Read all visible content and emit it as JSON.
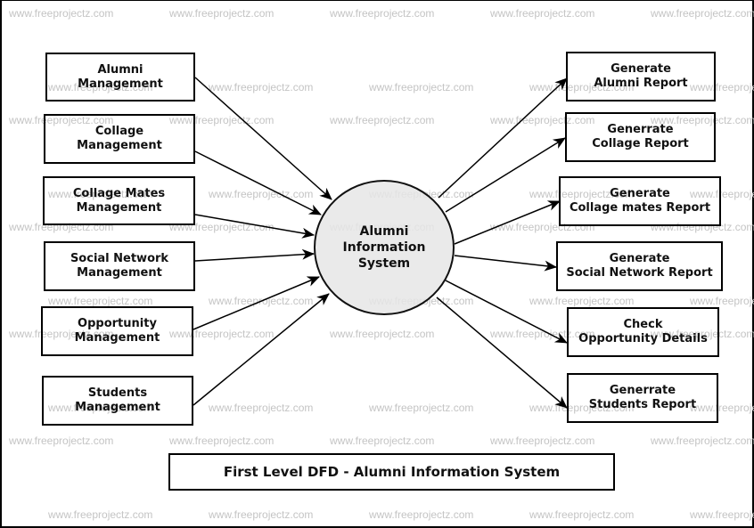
{
  "diagram": {
    "title": "First Level DFD - Alumni Information System",
    "watermark": "www.freeprojectz.com",
    "process": {
      "line1": "Alumni",
      "line2": "Information",
      "line3": "System"
    },
    "inputs": [
      {
        "line1": "Alumni",
        "line2": "Management"
      },
      {
        "line1": "Collage",
        "line2": "Management"
      },
      {
        "line1": "Collage Mates",
        "line2": "Management"
      },
      {
        "line1": "Social Network",
        "line2": "Management"
      },
      {
        "line1": "Opportunity",
        "line2": "Management"
      },
      {
        "line1": "Students",
        "line2": "Management"
      }
    ],
    "outputs": [
      {
        "line1": "Generate",
        "line2": "Alumni Report"
      },
      {
        "line1": "Generrate",
        "line2": "Collage Report"
      },
      {
        "line1": "Generate",
        "line2": "Collage mates Report"
      },
      {
        "line1": "Generate",
        "line2": "Social Network Report"
      },
      {
        "line1": "Check",
        "line2": "Opportunity Details"
      },
      {
        "line1": "Generrate",
        "line2": "Students Report"
      }
    ],
    "flows": [
      {
        "from": "inputs.0",
        "to": "process"
      },
      {
        "from": "inputs.1",
        "to": "process"
      },
      {
        "from": "inputs.2",
        "to": "process"
      },
      {
        "from": "inputs.3",
        "to": "process"
      },
      {
        "from": "inputs.4",
        "to": "process"
      },
      {
        "from": "inputs.5",
        "to": "process"
      },
      {
        "from": "process",
        "to": "outputs.0"
      },
      {
        "from": "process",
        "to": "outputs.1"
      },
      {
        "from": "process",
        "to": "outputs.2"
      },
      {
        "from": "process",
        "to": "outputs.3"
      },
      {
        "from": "process",
        "to": "outputs.4"
      },
      {
        "from": "process",
        "to": "outputs.5"
      }
    ]
  }
}
